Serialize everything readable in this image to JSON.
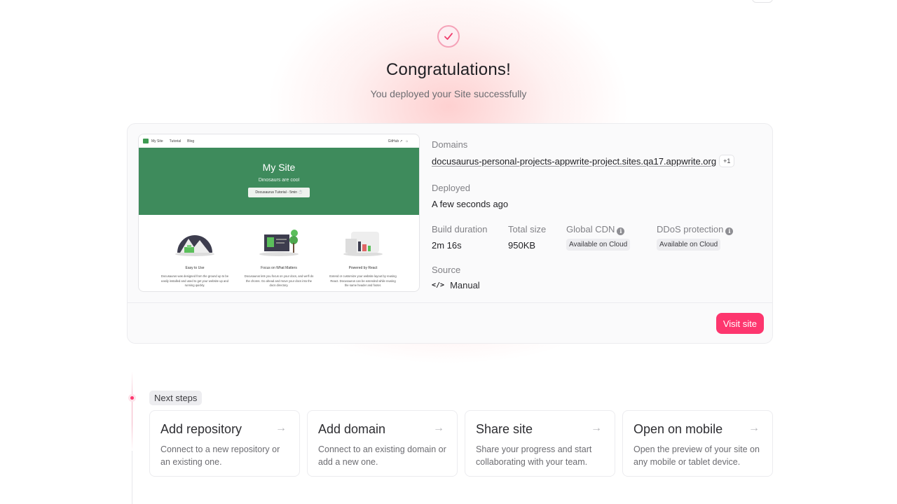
{
  "hero": {
    "title": "Congratulations!",
    "subtitle": "You deployed your Site successfully"
  },
  "preview": {
    "nav": {
      "site_name": "My Site",
      "links": [
        "Tutorial",
        "Blog"
      ],
      "github": "GitHub"
    },
    "hero": {
      "title": "My Site",
      "subtitle": "Dinosaurs are cool",
      "button": "Docusaurus Tutorial - 5min ⏱️"
    },
    "features": [
      {
        "title": "Easy to Use",
        "desc": "Docusaurus was designed from the ground up to be easily installed and used to get your website up and running quickly."
      },
      {
        "title": "Focus on What Matters",
        "desc": "Docusaurus lets you focus on your docs, and we'll do the chores. Go ahead and move your docs into the docs directory."
      },
      {
        "title": "Powered by React",
        "desc": "Extend or customize your website layout by reusing React. Docusaurus can be extended while reusing the same header and footer."
      }
    ]
  },
  "details": {
    "domains_label": "Domains",
    "domain": "docusaurus-personal-projects-appwrite-project.sites.qa17.appwrite.org",
    "domain_extra": "+1",
    "deployed_label": "Deployed",
    "deployed_value": "A few seconds ago",
    "build_label": "Build duration",
    "build_value": "2m 16s",
    "size_label": "Total size",
    "size_value": "950KB",
    "cdn_label": "Global CDN",
    "cdn_value": "Available on Cloud",
    "ddos_label": "DDoS protection",
    "ddos_value": "Available on Cloud",
    "source_label": "Source",
    "source_value": "Manual"
  },
  "footer": {
    "visit_label": "Visit site"
  },
  "next_steps": {
    "label": "Next steps",
    "items": [
      {
        "title": "Add repository",
        "desc": "Connect to a new repository or an existing one."
      },
      {
        "title": "Add domain",
        "desc": "Connect to an existing domain or add a new one."
      },
      {
        "title": "Share site",
        "desc": "Share your progress and start collaborating with your team."
      },
      {
        "title": "Open on mobile",
        "desc": "Open the preview of your site on any mobile or tablet device."
      }
    ]
  },
  "colors": {
    "accent": "#fd366e",
    "preview_green": "#3e8b5c"
  }
}
